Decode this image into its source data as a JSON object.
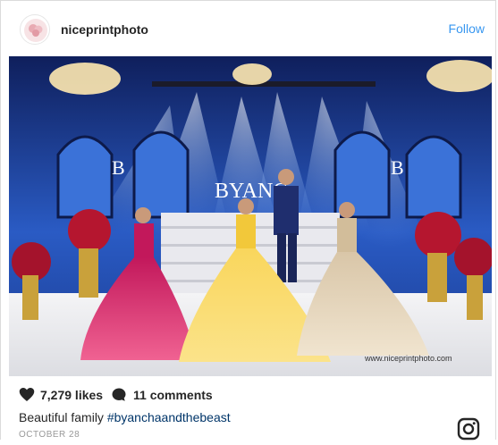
{
  "post": {
    "username": "niceprintphoto",
    "follow_label": "Follow",
    "photo_watermark": "www.niceprintphoto.com",
    "backdrop_monogram": "B",
    "backdrop_title": "BYANC",
    "likes": "7,279 likes",
    "comments": "11 comments",
    "caption_text": "Beautiful family ",
    "caption_hashtag": "#byanchaandthebeast",
    "date": "OCTOBER 28"
  },
  "icons": {
    "heart": "heart-icon",
    "comment": "comment-icon",
    "instagram": "instagram-icon"
  },
  "colors": {
    "link_blue": "#3897f0",
    "hashtag_blue": "#003569",
    "text_dark": "#262626",
    "date_gray": "#999999"
  }
}
